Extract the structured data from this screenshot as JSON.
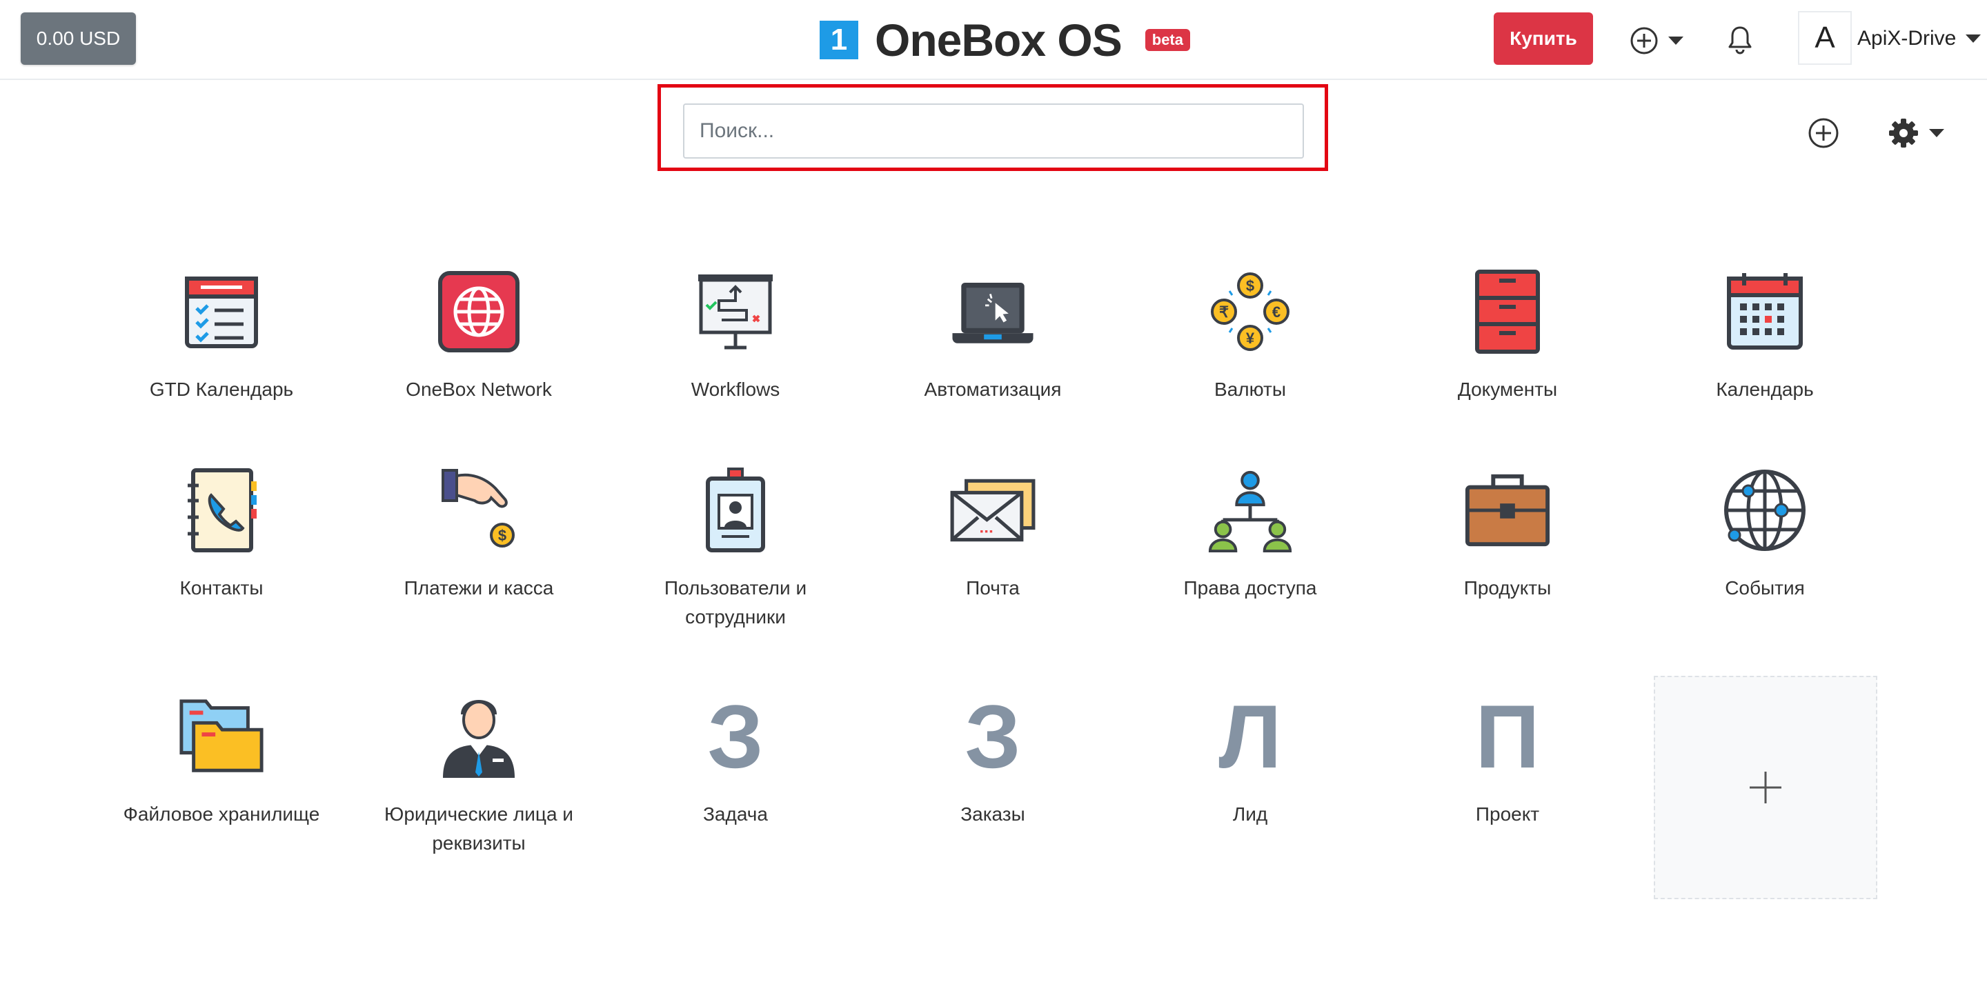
{
  "header": {
    "balance": "0.00 USD",
    "logo_mark": "1",
    "logo_text": "OneBox OS",
    "beta": "beta",
    "buy": "Купить",
    "user_initial": "A",
    "user_name": "ApiX-Drive"
  },
  "search": {
    "placeholder": "Поиск..."
  },
  "colors": {
    "accent": "#dc3545",
    "logo": "#1e9be6",
    "highlight": "#e30613",
    "letter": "#8593a3"
  },
  "apps": [
    {
      "label": "GTD Календарь",
      "icon": "gtd-calendar-icon"
    },
    {
      "label": "OneBox Network",
      "icon": "network-globe-icon"
    },
    {
      "label": "Workflows",
      "icon": "workflows-board-icon"
    },
    {
      "label": "Автоматизация",
      "icon": "laptop-automation-icon"
    },
    {
      "label": "Валюты",
      "icon": "currencies-icon"
    },
    {
      "label": "Документы",
      "icon": "documents-cabinet-icon"
    },
    {
      "label": "Календарь",
      "icon": "calendar-icon"
    },
    {
      "label": "Контакты",
      "icon": "contacts-book-icon"
    },
    {
      "label": "Платежи и касса",
      "icon": "payments-hand-icon"
    },
    {
      "label": "Пользователи и сотрудники",
      "icon": "user-badge-icon"
    },
    {
      "label": "Почта",
      "icon": "mail-envelope-icon"
    },
    {
      "label": "Права доступа",
      "icon": "access-rights-icon"
    },
    {
      "label": "Продукты",
      "icon": "products-briefcase-icon"
    },
    {
      "label": "События",
      "icon": "events-globe-icon"
    },
    {
      "label": "Файловое хранилище",
      "icon": "file-storage-folder-icon"
    },
    {
      "label": "Юридические лица и реквизиты",
      "icon": "legal-entity-person-icon"
    },
    {
      "label": "Задача",
      "letter": "З"
    },
    {
      "label": "Заказы",
      "letter": "З"
    },
    {
      "label": "Лид",
      "letter": "Л"
    },
    {
      "label": "Проект",
      "letter": "П"
    }
  ]
}
